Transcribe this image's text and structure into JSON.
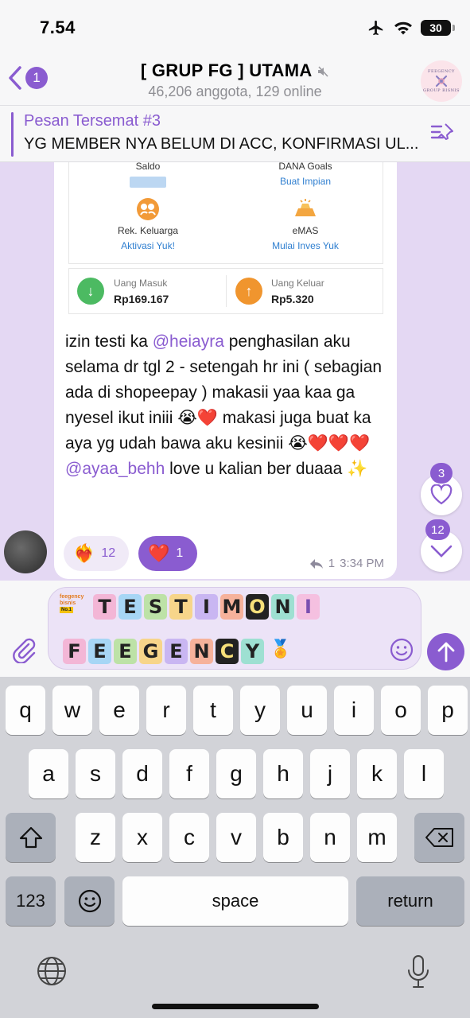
{
  "status": {
    "time": "7.54",
    "battery": "30",
    "icons": [
      "airplane-icon",
      "wifi-icon",
      "battery-icon"
    ]
  },
  "header": {
    "back_badge": "1",
    "title": "[ GRUP FG ] UTAMA",
    "subtitle": "46,206 anggota, 129 online",
    "avatar_text_top": "FEEGENCY",
    "avatar_text_bottom": "GROUP BISNIS"
  },
  "pinned": {
    "title": "Pesan Tersemat #3",
    "text": "YG MEMBER NYA BELUM DI ACC, KONFIRMASI UL..."
  },
  "screenshot": {
    "saldo_label": "Saldo",
    "goals_label": "DANA Goals",
    "goals_link": "Buat Impian",
    "keluarga_label": "Rek. Keluarga",
    "keluarga_link": "Aktivasi Yuk!",
    "emas_label": "eMAS",
    "emas_link": "Mulai Inves Yuk",
    "masuk_label": "Uang Masuk",
    "masuk_value": "Rp169.167",
    "keluar_label": "Uang Keluar",
    "keluar_value": "Rp5.320"
  },
  "message": {
    "t1": "izin testi ka ",
    "mention1": "@heiayra",
    "t2": " penghasilan aku selama dr tgl 2 - setengah hr ini ( sebagian ada di shopeepay ) makasii yaa kaa ga nyesel ikut iniii ",
    "e1": "😭",
    "h1": "❤️",
    "t3": " makasi juga buat ka aya yg udah bawa aku kesinii ",
    "e2": "😭",
    "h2": "❤️❤️❤️",
    "mention2": "@ayaa_behh",
    "t4": " love u kalian ber duaaa ",
    "e3": "✨",
    "time": "3:34 PM",
    "reply_count": "1"
  },
  "reactions": [
    {
      "emoji": "❤️‍🔥",
      "count": "12"
    },
    {
      "emoji": "❤️",
      "count": "1"
    }
  ],
  "floating": {
    "reactions_badge": "3",
    "mentions_badge": "12"
  },
  "composer": {
    "logo_line1": "feegency",
    "logo_line2": "bisnis",
    "logo_badge": "No.1",
    "row1": [
      "T",
      "E",
      "S",
      "T",
      "I",
      "M",
      "O",
      "N",
      "I"
    ],
    "row2": [
      "F",
      "E",
      "E",
      "G",
      "E",
      "N",
      "C",
      "Y"
    ],
    "row2_emoji": "🏅"
  },
  "keyboard": {
    "row1": [
      "q",
      "w",
      "e",
      "r",
      "t",
      "y",
      "u",
      "i",
      "o",
      "p"
    ],
    "row2": [
      "a",
      "s",
      "d",
      "f",
      "g",
      "h",
      "j",
      "k",
      "l"
    ],
    "row3": [
      "z",
      "x",
      "c",
      "v",
      "b",
      "n",
      "m"
    ],
    "numbers": "123",
    "space": "space",
    "return": "return"
  },
  "colors": {
    "accent": "#8a5cd0",
    "chat_bg": "#e4d8f3",
    "heart": "#e0242c"
  }
}
